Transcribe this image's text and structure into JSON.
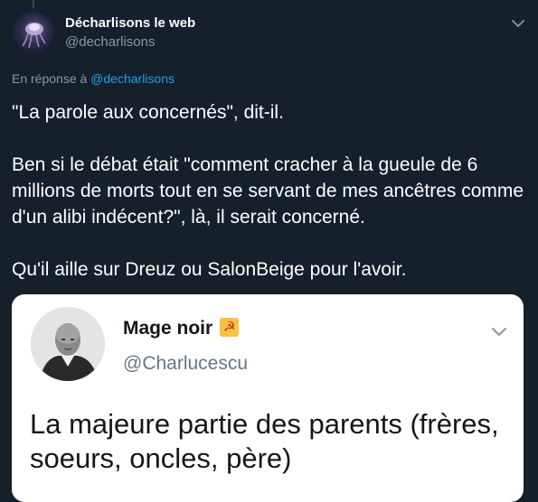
{
  "tweet": {
    "author_name": "Décharlisons le web",
    "author_handle": "@decharlisons",
    "reply_prefix": "En réponse à ",
    "reply_handle": "@decharlisons",
    "paragraphs": [
      "\"La parole aux concernés\", dit-il.",
      "Ben si le débat était \"comment cracher à la gueule de 6 millions de morts tout en se servant de mes ancêtres comme d'un alibi indécent?\", là, il serait concerné.",
      "Qu'il aille sur Dreuz ou SalonBeige pour l'avoir."
    ]
  },
  "quoted_tweet": {
    "author_name": "Mage noir",
    "author_handle": "@Charlucescu",
    "emoji": "☭",
    "text": "La majeure partie des parents (frères, soeurs, oncles, père)"
  },
  "icons": {
    "caret": "chevron-down-icon",
    "avatar": "avatar"
  },
  "colors": {
    "background": "#15202b",
    "link": "#1da1f2",
    "muted": "#8899a6",
    "card": "#ffffff"
  }
}
